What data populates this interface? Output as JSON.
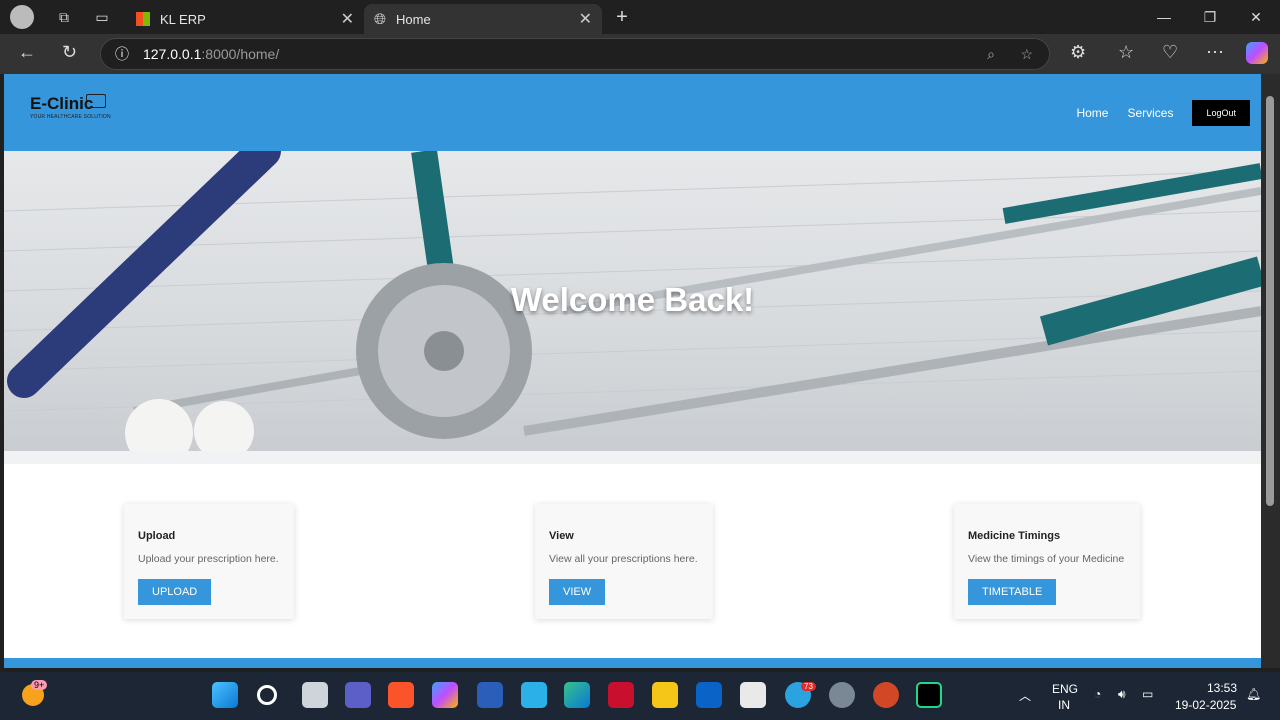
{
  "browser": {
    "tabs": [
      {
        "label": "KL ERP",
        "active": false
      },
      {
        "label": "Home",
        "active": true
      }
    ],
    "url": {
      "host": "127.0.0.1",
      "rest": ":8000/home/"
    }
  },
  "app": {
    "logo_name": "E-Clinic",
    "logo_tagline": "YOUR HEALTHCARE SOLUTION",
    "nav": {
      "home": "Home",
      "services": "Services",
      "logout": "LogOut"
    },
    "hero_title": "Welcome Back!",
    "cards": [
      {
        "title": "Upload",
        "text": "Upload your prescription here.",
        "button": "UPLOAD"
      },
      {
        "title": "View",
        "text": "View all your prescriptions here.",
        "button": "VIEW"
      },
      {
        "title": "Medicine Timings",
        "text": "View the timings of your Medicine",
        "button": "TIMETABLE"
      }
    ],
    "colors": {
      "primary": "#3596db",
      "logout_bg": "#000000"
    }
  },
  "taskbar": {
    "lang_top": "ENG",
    "lang_bottom": "IN",
    "time": "13:53",
    "date": "19-02-2025",
    "weather_badge": "9+",
    "telegram_badge": "73"
  }
}
